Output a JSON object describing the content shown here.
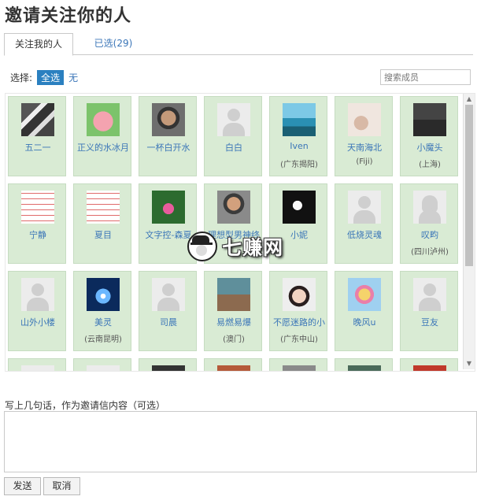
{
  "page": {
    "title": "邀请关注你的人"
  },
  "tabs": [
    {
      "label": "关注我的人",
      "active": true
    },
    {
      "label": "已选(29)",
      "active": false
    }
  ],
  "selector": {
    "label": "选择:",
    "all": "全选",
    "none": "无"
  },
  "search": {
    "placeholder": "搜索成员"
  },
  "members": [
    {
      "name": "五二一",
      "location": "",
      "avatar": "qr-photo-icon"
    },
    {
      "name": "正义的水冰月",
      "location": "",
      "avatar": "cartoon-pig-icon"
    },
    {
      "name": "一杯白开水",
      "location": "",
      "avatar": "man-sunglasses-photo"
    },
    {
      "name": "白白",
      "location": "",
      "avatar": "default-avatar-icon"
    },
    {
      "name": "Iven",
      "location": "(广东揭阳)",
      "avatar": "sea-photo"
    },
    {
      "name": "天南海北",
      "location": "(Fiji)",
      "avatar": "sketch-photo"
    },
    {
      "name": "小魔头",
      "location": "(上海)",
      "avatar": "sign-photo"
    },
    {
      "name": "宁静",
      "location": "",
      "avatar": "text-card-photo"
    },
    {
      "name": "夏目",
      "location": "",
      "avatar": "text-card-photo"
    },
    {
      "name": "文字控-森夏",
      "location": "",
      "avatar": "lotus-photo"
    },
    {
      "name": "理想型男神终",
      "location": "",
      "avatar": "man-photo"
    },
    {
      "name": "小妮",
      "location": "",
      "avatar": "white-flower-photo"
    },
    {
      "name": "低烧灵魂",
      "location": "",
      "avatar": "default-avatar-icon"
    },
    {
      "name": "叹畇",
      "location": "(四川泸州)",
      "avatar": "default-female-avatar-icon"
    },
    {
      "name": "山外小楼",
      "location": "",
      "avatar": "default-avatar-icon"
    },
    {
      "name": "美灵",
      "location": "(云南昆明)",
      "avatar": "space-light-photo"
    },
    {
      "name": "司晨",
      "location": "",
      "avatar": "default-avatar-icon"
    },
    {
      "name": "易燃易爆",
      "location": "(澳门)",
      "avatar": "group-photo"
    },
    {
      "name": "不愿迷路的小",
      "location": "(广东中山)",
      "avatar": "girl-photo"
    },
    {
      "name": "晚风u",
      "location": "",
      "avatar": "anime-photo"
    },
    {
      "name": "豆友",
      "location": "",
      "avatar": "default-avatar-icon"
    }
  ],
  "watermark": {
    "text": "七赚网"
  },
  "message": {
    "label": "写上几句话，作为邀请信内容（可选）",
    "value": ""
  },
  "buttons": {
    "send": "发送",
    "cancel": "取消"
  },
  "colors": {
    "card_bg": "#d9ebd4",
    "link": "#3b76b8",
    "select_all_bg": "#2b80c0"
  }
}
